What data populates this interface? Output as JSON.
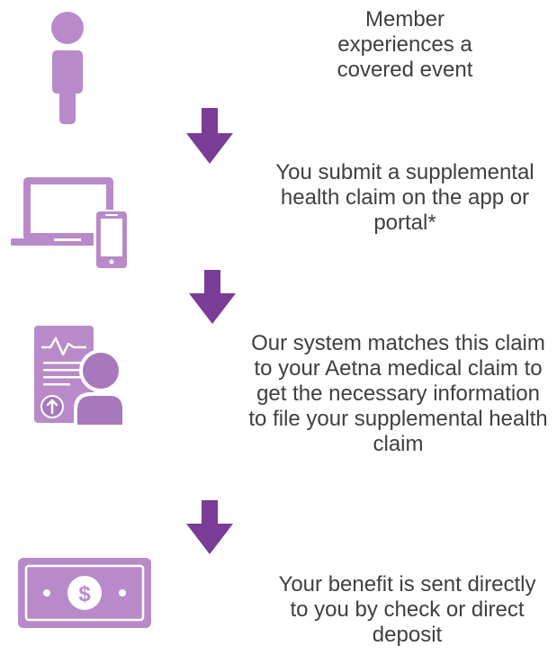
{
  "colors": {
    "icon_light": "#b98ac9",
    "icon_mid": "#a778bb",
    "arrow": "#7a3c96",
    "text": "#3f3f3f"
  },
  "steps": [
    {
      "icon": "person-icon",
      "text": "Member experiences a covered event"
    },
    {
      "icon": "laptop-phone-icon",
      "text": "You submit a supplemental health claim on the app or portal*"
    },
    {
      "icon": "document-person-icon",
      "text": "Our system matches this claim to your Aetna medical claim to get the necessary information to file your supplemental health claim"
    },
    {
      "icon": "dollar-bill-icon",
      "text": "Your benefit is sent directly to you by check or direct deposit"
    }
  ]
}
